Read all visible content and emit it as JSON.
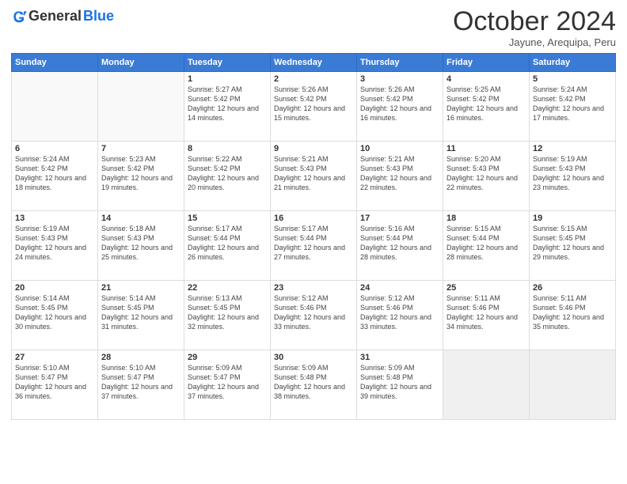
{
  "logo": {
    "general": "General",
    "blue": "Blue"
  },
  "title": "October 2024",
  "location": "Jayune, Arequipa, Peru",
  "headers": [
    "Sunday",
    "Monday",
    "Tuesday",
    "Wednesday",
    "Thursday",
    "Friday",
    "Saturday"
  ],
  "weeks": [
    [
      {
        "day": "",
        "info": ""
      },
      {
        "day": "",
        "info": ""
      },
      {
        "day": "1",
        "info": "Sunrise: 5:27 AM\nSunset: 5:42 PM\nDaylight: 12 hours and 14 minutes."
      },
      {
        "day": "2",
        "info": "Sunrise: 5:26 AM\nSunset: 5:42 PM\nDaylight: 12 hours and 15 minutes."
      },
      {
        "day": "3",
        "info": "Sunrise: 5:26 AM\nSunset: 5:42 PM\nDaylight: 12 hours and 16 minutes."
      },
      {
        "day": "4",
        "info": "Sunrise: 5:25 AM\nSunset: 5:42 PM\nDaylight: 12 hours and 16 minutes."
      },
      {
        "day": "5",
        "info": "Sunrise: 5:24 AM\nSunset: 5:42 PM\nDaylight: 12 hours and 17 minutes."
      }
    ],
    [
      {
        "day": "6",
        "info": "Sunrise: 5:24 AM\nSunset: 5:42 PM\nDaylight: 12 hours and 18 minutes."
      },
      {
        "day": "7",
        "info": "Sunrise: 5:23 AM\nSunset: 5:42 PM\nDaylight: 12 hours and 19 minutes."
      },
      {
        "day": "8",
        "info": "Sunrise: 5:22 AM\nSunset: 5:42 PM\nDaylight: 12 hours and 20 minutes."
      },
      {
        "day": "9",
        "info": "Sunrise: 5:21 AM\nSunset: 5:43 PM\nDaylight: 12 hours and 21 minutes."
      },
      {
        "day": "10",
        "info": "Sunrise: 5:21 AM\nSunset: 5:43 PM\nDaylight: 12 hours and 22 minutes."
      },
      {
        "day": "11",
        "info": "Sunrise: 5:20 AM\nSunset: 5:43 PM\nDaylight: 12 hours and 22 minutes."
      },
      {
        "day": "12",
        "info": "Sunrise: 5:19 AM\nSunset: 5:43 PM\nDaylight: 12 hours and 23 minutes."
      }
    ],
    [
      {
        "day": "13",
        "info": "Sunrise: 5:19 AM\nSunset: 5:43 PM\nDaylight: 12 hours and 24 minutes."
      },
      {
        "day": "14",
        "info": "Sunrise: 5:18 AM\nSunset: 5:43 PM\nDaylight: 12 hours and 25 minutes."
      },
      {
        "day": "15",
        "info": "Sunrise: 5:17 AM\nSunset: 5:44 PM\nDaylight: 12 hours and 26 minutes."
      },
      {
        "day": "16",
        "info": "Sunrise: 5:17 AM\nSunset: 5:44 PM\nDaylight: 12 hours and 27 minutes."
      },
      {
        "day": "17",
        "info": "Sunrise: 5:16 AM\nSunset: 5:44 PM\nDaylight: 12 hours and 28 minutes."
      },
      {
        "day": "18",
        "info": "Sunrise: 5:15 AM\nSunset: 5:44 PM\nDaylight: 12 hours and 28 minutes."
      },
      {
        "day": "19",
        "info": "Sunrise: 5:15 AM\nSunset: 5:45 PM\nDaylight: 12 hours and 29 minutes."
      }
    ],
    [
      {
        "day": "20",
        "info": "Sunrise: 5:14 AM\nSunset: 5:45 PM\nDaylight: 12 hours and 30 minutes."
      },
      {
        "day": "21",
        "info": "Sunrise: 5:14 AM\nSunset: 5:45 PM\nDaylight: 12 hours and 31 minutes."
      },
      {
        "day": "22",
        "info": "Sunrise: 5:13 AM\nSunset: 5:45 PM\nDaylight: 12 hours and 32 minutes."
      },
      {
        "day": "23",
        "info": "Sunrise: 5:12 AM\nSunset: 5:46 PM\nDaylight: 12 hours and 33 minutes."
      },
      {
        "day": "24",
        "info": "Sunrise: 5:12 AM\nSunset: 5:46 PM\nDaylight: 12 hours and 33 minutes."
      },
      {
        "day": "25",
        "info": "Sunrise: 5:11 AM\nSunset: 5:46 PM\nDaylight: 12 hours and 34 minutes."
      },
      {
        "day": "26",
        "info": "Sunrise: 5:11 AM\nSunset: 5:46 PM\nDaylight: 12 hours and 35 minutes."
      }
    ],
    [
      {
        "day": "27",
        "info": "Sunrise: 5:10 AM\nSunset: 5:47 PM\nDaylight: 12 hours and 36 minutes."
      },
      {
        "day": "28",
        "info": "Sunrise: 5:10 AM\nSunset: 5:47 PM\nDaylight: 12 hours and 37 minutes."
      },
      {
        "day": "29",
        "info": "Sunrise: 5:09 AM\nSunset: 5:47 PM\nDaylight: 12 hours and 37 minutes."
      },
      {
        "day": "30",
        "info": "Sunrise: 5:09 AM\nSunset: 5:48 PM\nDaylight: 12 hours and 38 minutes."
      },
      {
        "day": "31",
        "info": "Sunrise: 5:09 AM\nSunset: 5:48 PM\nDaylight: 12 hours and 39 minutes."
      },
      {
        "day": "",
        "info": ""
      },
      {
        "day": "",
        "info": ""
      }
    ]
  ]
}
